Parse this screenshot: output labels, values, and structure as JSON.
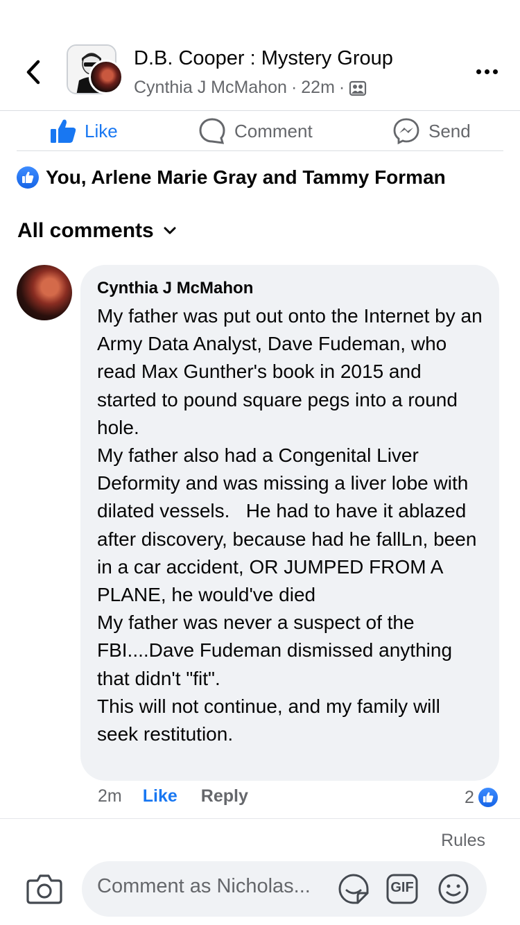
{
  "header": {
    "group_title": "D.B. Cooper : Mystery Group",
    "author": "Cynthia J McMahon",
    "time": "22m",
    "separator": "·"
  },
  "actions": {
    "like": "Like",
    "comment": "Comment",
    "send": "Send"
  },
  "reactions": {
    "text": "You, Arlene Marie Gray and Tammy Forman"
  },
  "comments_filter": {
    "label": "All comments"
  },
  "comment": {
    "author": "Cynthia J McMahon",
    "text": "My father was put out onto the Internet by an Army Data Analyst, Dave Fudeman, who read Max Gunther's book in 2015 and started to pound square pegs into a round hole.\nMy father also had a Congenital Liver Deformity and was missing a liver lobe with dilated vessels.   He had to have it ablazed after discovery, because had he fallLn, been in a car accident, OR JUMPED FROM A PLANE, he would've died\nMy father was never a suspect of the FBI....Dave Fudeman dismissed anything that didn't \"fit\".\nThis will not continue, and my family will seek restitution.",
    "time": "2m",
    "like_label": "Like",
    "reply_label": "Reply",
    "reaction_count": "2"
  },
  "composer": {
    "rules_label": "Rules",
    "placeholder": "Comment as Nicholas...",
    "gif_label": "GIF"
  },
  "colors": {
    "brand_blue": "#1877f2",
    "secondary_text": "#65676b",
    "bubble_bg": "#f0f2f5"
  }
}
